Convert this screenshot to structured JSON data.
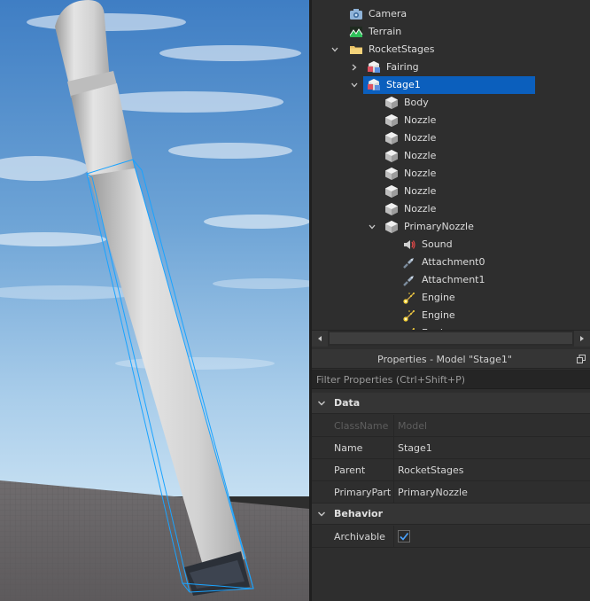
{
  "explorer": {
    "items": [
      {
        "label": "Camera",
        "icon": "camera-icon",
        "depth": 1,
        "expander": "none"
      },
      {
        "label": "Terrain",
        "icon": "terrain-icon",
        "depth": 1,
        "expander": "none"
      },
      {
        "label": "RocketStages",
        "icon": "folder-icon",
        "depth": 1,
        "expander": "expanded"
      },
      {
        "label": "Fairing",
        "icon": "model-icon",
        "depth": 2,
        "expander": "collapsed"
      },
      {
        "label": "Stage1",
        "icon": "model-icon",
        "depth": 2,
        "expander": "expanded",
        "selected": true
      },
      {
        "label": "Body",
        "icon": "part-icon",
        "depth": 3,
        "expander": "none"
      },
      {
        "label": "Nozzle",
        "icon": "part-icon",
        "depth": 3,
        "expander": "none"
      },
      {
        "label": "Nozzle",
        "icon": "part-icon",
        "depth": 3,
        "expander": "none"
      },
      {
        "label": "Nozzle",
        "icon": "part-icon",
        "depth": 3,
        "expander": "none"
      },
      {
        "label": "Nozzle",
        "icon": "part-icon",
        "depth": 3,
        "expander": "none"
      },
      {
        "label": "Nozzle",
        "icon": "part-icon",
        "depth": 3,
        "expander": "none"
      },
      {
        "label": "Nozzle",
        "icon": "part-icon",
        "depth": 3,
        "expander": "none"
      },
      {
        "label": "PrimaryNozzle",
        "icon": "part-icon",
        "depth": 3,
        "expander": "expanded"
      },
      {
        "label": "Sound",
        "icon": "sound-icon",
        "depth": 4,
        "expander": "none"
      },
      {
        "label": "Attachment0",
        "icon": "attachment-icon",
        "depth": 4,
        "expander": "none"
      },
      {
        "label": "Attachment1",
        "icon": "attachment-icon",
        "depth": 4,
        "expander": "none"
      },
      {
        "label": "Engine",
        "icon": "sparkle-icon",
        "depth": 4,
        "expander": "none"
      },
      {
        "label": "Engine",
        "icon": "sparkle-icon",
        "depth": 4,
        "expander": "none"
      },
      {
        "label": "Engine",
        "icon": "sparkle-icon",
        "depth": 4,
        "expander": "none"
      }
    ]
  },
  "properties": {
    "title": "Properties - Model \"Stage1\"",
    "filter_placeholder": "Filter Properties (Ctrl+Shift+P)",
    "sections": {
      "data": {
        "label": "Data",
        "rows": [
          {
            "name": "ClassName",
            "value": "Model",
            "disabled": true
          },
          {
            "name": "Name",
            "value": "Stage1"
          },
          {
            "name": "Parent",
            "value": "RocketStages"
          },
          {
            "name": "PrimaryPart",
            "value": "PrimaryNozzle"
          }
        ]
      },
      "behavior": {
        "label": "Behavior",
        "rows": [
          {
            "name": "Archivable",
            "checked": true
          }
        ]
      }
    }
  },
  "colors": {
    "selection": "#0b5fbd",
    "checkmark": "#4aa3ff",
    "panel_bg": "#2e2e2e",
    "selection_box": "#1aa3ff"
  }
}
